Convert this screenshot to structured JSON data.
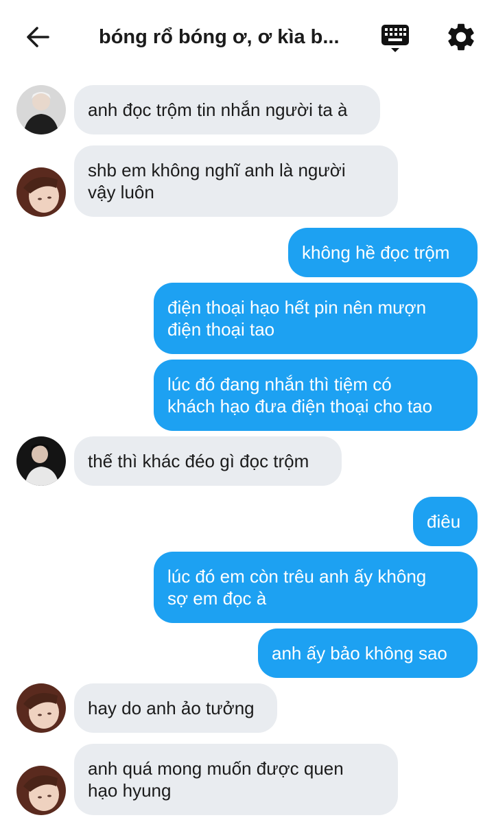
{
  "header": {
    "title": "bóng rổ bóng ơ, ơ kìa b...",
    "back_icon": "arrow-left-icon",
    "keyboard_icon": "keyboard-icon",
    "settings_icon": "gear-icon"
  },
  "colors": {
    "outgoing_bubble": "#1da1f2",
    "incoming_bubble": "#e9ecf0",
    "text_dark": "#1b1b1b",
    "text_light": "#ffffff"
  },
  "messages": [
    {
      "direction": "incoming",
      "text": "anh đọc trộm tin nhắn người ta à",
      "avatar": "avatar-user-1"
    },
    {
      "direction": "incoming",
      "text": "shb em không nghĩ anh là người\nvậy luôn",
      "avatar": "avatar-user-2"
    },
    {
      "direction": "outgoing",
      "text": "không hề đọc trộm"
    },
    {
      "direction": "outgoing",
      "text": "điện thoại hạo hết pin nên mượn\nđiện thoại tao"
    },
    {
      "direction": "outgoing",
      "text": "lúc đó đang nhắn thì tiệm có\nkhách hạo đưa điện thoại cho tao"
    },
    {
      "direction": "incoming",
      "text": "thế thì khác đéo gì đọc trộm",
      "avatar": "avatar-user-3"
    },
    {
      "direction": "outgoing",
      "text": "điêu"
    },
    {
      "direction": "outgoing",
      "text": "lúc đó em còn trêu anh ấy không\nsợ em đọc à"
    },
    {
      "direction": "outgoing",
      "text": "anh ấy bảo không sao"
    },
    {
      "direction": "incoming",
      "text": "hay do anh ảo tưởng",
      "avatar": "avatar-user-2"
    },
    {
      "direction": "incoming",
      "text": "anh quá mong muốn được quen\nhạo hyung",
      "avatar": "avatar-user-2"
    }
  ]
}
